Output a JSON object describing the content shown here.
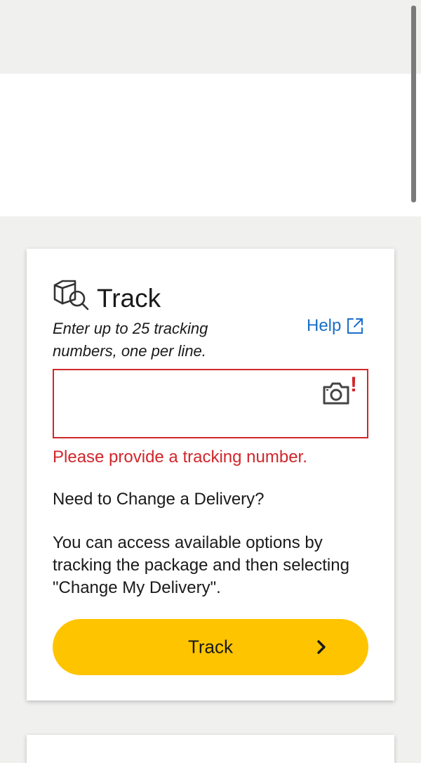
{
  "track_card": {
    "title": "Track",
    "instructions": "Enter up to 25 tracking numbers, one per line.",
    "help_label": "Help",
    "input_value": "",
    "error_message": "Please provide a tracking number.",
    "change_delivery_heading": "Need to Change a Delivery?",
    "change_delivery_body": "You can access available options by tracking the package and then selecting \"Change My Delivery\".",
    "track_button_label": "Track"
  },
  "icons": {
    "title_icon": "package-search-icon",
    "help_icon": "external-link-icon",
    "camera_icon": "camera-icon",
    "error_icon": "exclamation-icon",
    "button_icon": "chevron-right-icon"
  },
  "colors": {
    "accent_yellow": "#ffc400",
    "error_red": "#d1262b",
    "link_blue": "#1a6fc9",
    "page_background": "#f0f0ef"
  }
}
